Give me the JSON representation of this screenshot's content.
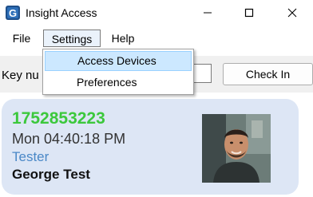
{
  "window": {
    "title": "Insight Access",
    "icon": "insight-access-logo",
    "controls": [
      "minimize-icon",
      "maximize-icon",
      "close-icon"
    ]
  },
  "menu": {
    "file": "File",
    "settings": "Settings",
    "help": "Help"
  },
  "settings_dropdown": {
    "items": [
      "Access Devices",
      "Preferences"
    ],
    "highlighted_index": 0
  },
  "toolbar": {
    "key_label": "Key nu",
    "key_value": "",
    "checkin_label": "Check In"
  },
  "card": {
    "id": "1752853223",
    "time": "Mon 04:40:18 PM",
    "role": "Tester",
    "name": "George Test",
    "photo": "user-photo"
  },
  "colors": {
    "id_green": "#3cc83c",
    "role_blue": "#4a88c7",
    "card_bg": "#dde6f5",
    "highlight": "#cce8ff"
  }
}
